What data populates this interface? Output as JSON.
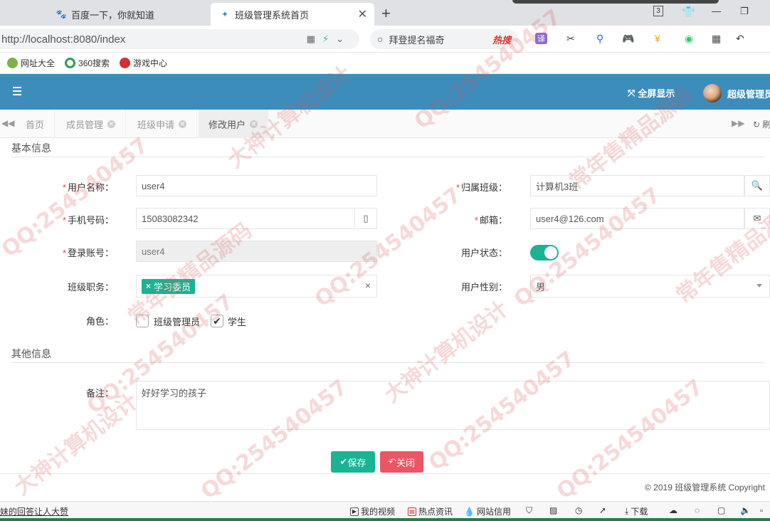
{
  "browser": {
    "tabs": [
      {
        "label": "百度一下，你就知道",
        "icon": "baidu-paw-icon"
      },
      {
        "label": "班级管理系统首页",
        "icon": "leaf-icon"
      }
    ],
    "tab_count": "3",
    "url": "http://localhost:8080/index",
    "search_placeholder": "拜登提名福奇",
    "hot_label": "热搜",
    "bookmarks": [
      {
        "label": "网址大全",
        "color": "#7cb342"
      },
      {
        "label": "360搜索",
        "color": "#2e9e4d"
      },
      {
        "label": "游戏中心",
        "color": "#d32f2f"
      }
    ]
  },
  "header": {
    "fullscreen_label": "全屏显示",
    "user_name": "超级管理员"
  },
  "page_tabs": {
    "items": [
      {
        "label": "首页"
      },
      {
        "label": "成员管理"
      },
      {
        "label": "班级申请"
      },
      {
        "label": "修改用户"
      }
    ],
    "refresh_label": "刷"
  },
  "form": {
    "section_basic": "基本信息",
    "section_other": "其他信息",
    "user_name": {
      "label": "用户名称：",
      "value": "user4"
    },
    "class": {
      "label": "归属班级：",
      "value": "计算机3班"
    },
    "phone": {
      "label": "手机号码：",
      "value": "15083082342"
    },
    "email": {
      "label": "邮箱：",
      "value": "user4@126.com"
    },
    "login": {
      "label": "登录账号：",
      "value": "user4"
    },
    "status": {
      "label": "用户状态：",
      "enabled": true
    },
    "duty": {
      "label": "班级职务：",
      "chips": [
        "学习委员"
      ]
    },
    "gender": {
      "label": "用户性别：",
      "value": "男"
    },
    "role": {
      "label": "角色：",
      "options": [
        {
          "label": "班级管理员",
          "checked": false
        },
        {
          "label": "学生",
          "checked": true
        }
      ]
    },
    "remark": {
      "label": "备注：",
      "value": "好好学习的孩子"
    },
    "save_label": "保存",
    "close_label": "关闭"
  },
  "footer": {
    "copyright": "© 2019 班级管理系统 Copyright"
  },
  "statusbar": {
    "news": "妹的回答让人大赞",
    "items": [
      "我的视频",
      "热点资讯",
      "网站信用",
      "下载"
    ]
  },
  "watermark": {
    "texts": [
      "QQ:254540457",
      "大神计算机设计",
      "常年售精品源码"
    ]
  },
  "colors": {
    "header": "#3c8dbc",
    "primary": "#1ab394",
    "danger": "#ed5565",
    "required": "#e74c3c"
  }
}
